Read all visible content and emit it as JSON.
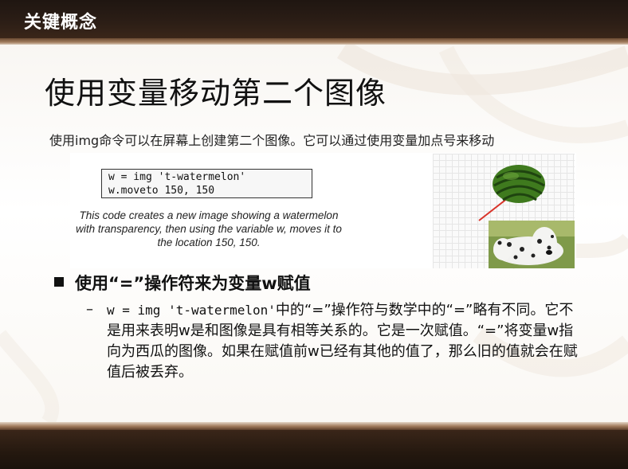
{
  "header": {
    "title": "关键概念"
  },
  "slide": {
    "title": "使用变量移动第二个图像",
    "subtitle": "使用img命令可以在屏幕上创建第二个图像。它可以通过使用变量加点号来移动"
  },
  "figure": {
    "code_lines": [
      "w = img 't-watermelon'",
      "w.moveto 150, 150"
    ],
    "caption": "This code creates a new image showing a watermelon with transparency, then using the variable w, moves it to the location 150, 150."
  },
  "bullet": {
    "text": "使用“=”操作符来为变量w赋值",
    "sub_code": "w = img 't-watermelon'",
    "sub_text": "中的“=”操作符与数学中的“=”略有不同。它不是用来表明w是和图像是具有相等关系的。它是一次赋值。“=”将变量w指向为西瓜的图像。如果在赋值前w已经有其他的值了，那么旧的值就会在赋值后被丢弃。"
  },
  "colors": {
    "band": "#2c1e16",
    "accent": "#a07b5c",
    "watermelon": "#3f7a1e",
    "arrow": "#d9342a"
  },
  "icons": [
    "watermelon-image",
    "dalmatian-dog-image",
    "arrow-line"
  ]
}
